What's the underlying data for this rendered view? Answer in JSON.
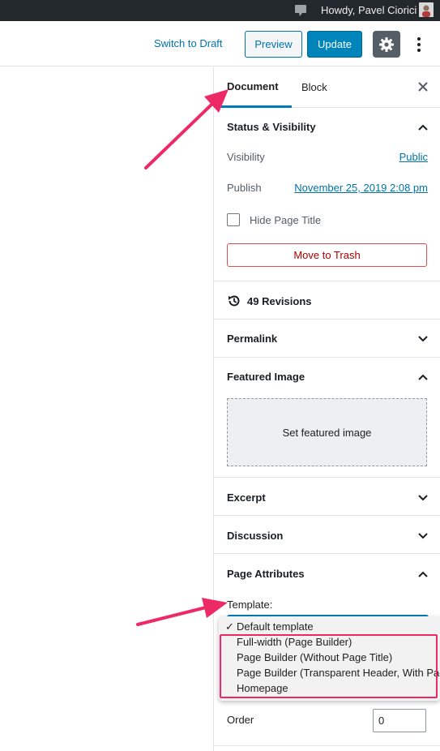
{
  "admin_bar": {
    "greeting": "Howdy, Pavel Ciorici",
    "icons": {
      "notifications": "comment-bubble-icon",
      "avatar": "user-avatar"
    }
  },
  "header": {
    "switch_to_draft": "Switch to Draft",
    "preview": "Preview",
    "update": "Update",
    "icons": {
      "settings": "gear-icon",
      "more": "vertical-ellipsis-icon"
    }
  },
  "sidebar": {
    "tabs": [
      {
        "label": "Document",
        "active": true
      },
      {
        "label": "Block",
        "active": false
      }
    ],
    "close_icon": "close-icon",
    "status_visibility": {
      "title": "Status & Visibility",
      "visibility_label": "Visibility",
      "visibility_value": "Public",
      "publish_label": "Publish",
      "publish_value": "November 25, 2019 2:08 pm",
      "hide_title_label": "Hide Page Title",
      "hide_title_checked": false,
      "trash_label": "Move to Trash"
    },
    "revisions": {
      "label": "49 Revisions",
      "icon": "history-icon"
    },
    "permalink": {
      "title": "Permalink"
    },
    "featured_image": {
      "title": "Featured Image",
      "button": "Set featured image"
    },
    "excerpt": {
      "title": "Excerpt"
    },
    "discussion": {
      "title": "Discussion"
    },
    "page_attributes": {
      "title": "Page Attributes",
      "template_label": "Template:",
      "template_options": [
        {
          "label": "Default template",
          "selected": true
        },
        {
          "label": "Full-width (Page Builder)",
          "selected": false
        },
        {
          "label": "Page Builder (Without Page Title)",
          "selected": false
        },
        {
          "label": "Page Builder (Transparent Header, With Page Title)",
          "selected": false
        },
        {
          "label": "Homepage",
          "selected": false
        }
      ],
      "order_label": "Order",
      "order_value": "0"
    }
  },
  "colors": {
    "accent": "#0085ba",
    "link": "#0073aa",
    "annotation": "#ee2a66",
    "admin_bar": "#23282d"
  }
}
